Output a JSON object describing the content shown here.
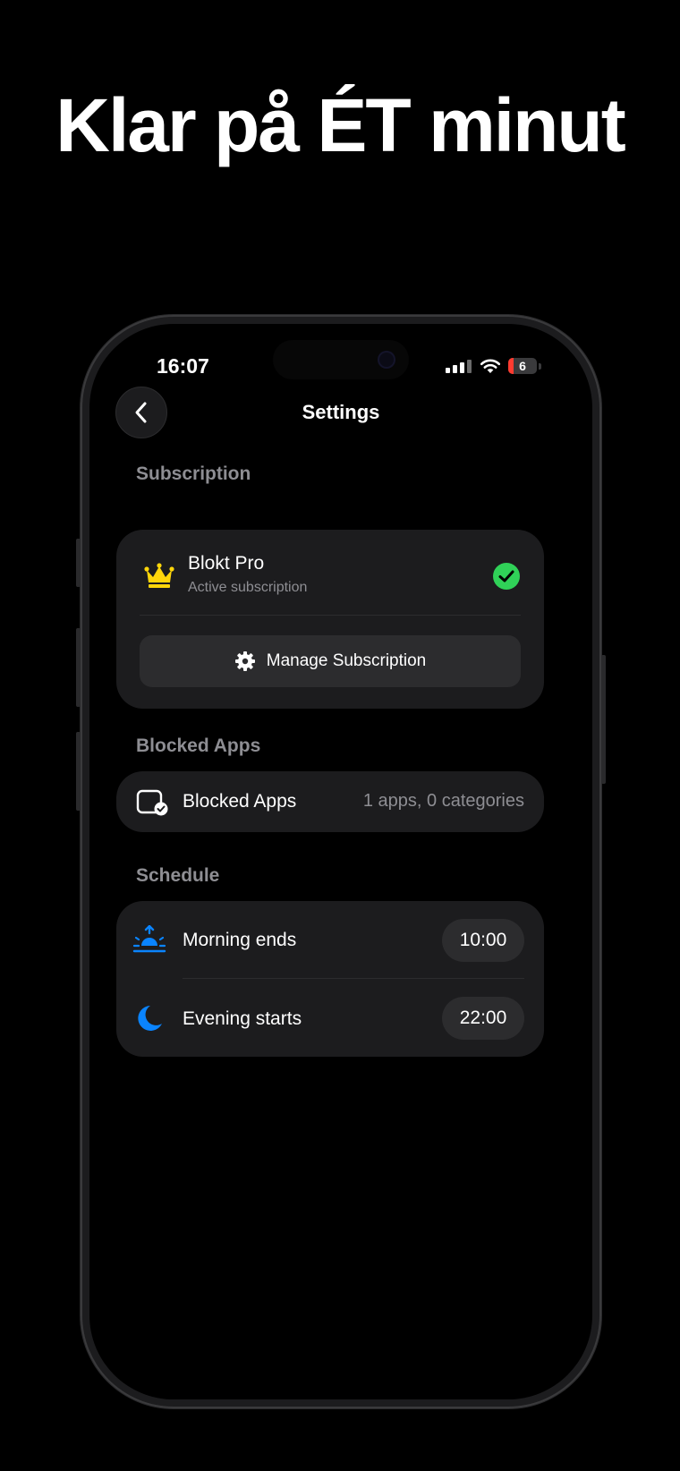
{
  "headline": "Klar på ÉT minut",
  "status_bar": {
    "time": "16:07",
    "battery_level": "6"
  },
  "header": {
    "title": "Settings"
  },
  "subscription": {
    "section_label": "Subscription",
    "plan_name": "Blokt Pro",
    "plan_status": "Active subscription",
    "manage_label": "Manage Subscription"
  },
  "blocked_apps": {
    "section_label": "Blocked Apps",
    "row_label": "Blocked Apps",
    "row_value": "1 apps, 0 categories"
  },
  "schedule": {
    "section_label": "Schedule",
    "rows": [
      {
        "label": "Morning ends",
        "time": "10:00",
        "icon": "sunrise-icon"
      },
      {
        "label": "Evening starts",
        "time": "22:00",
        "icon": "moon-icon"
      }
    ]
  },
  "colors": {
    "accent_blue": "#0a84ff",
    "crown_gold": "#ffd60a",
    "success_green": "#30d158",
    "card_bg": "#1c1c1e",
    "secondary_text": "#8e8e93"
  }
}
